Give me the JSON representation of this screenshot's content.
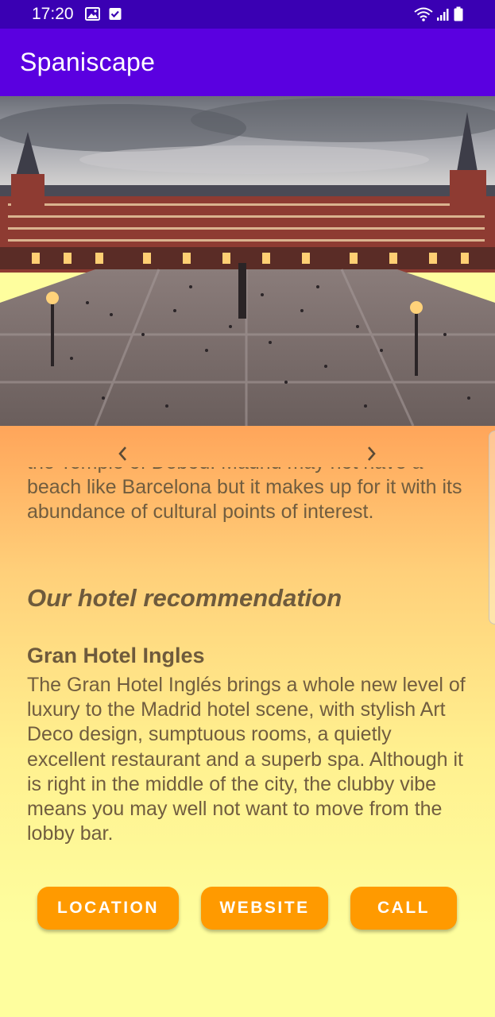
{
  "status_bar": {
    "time": "17:20",
    "left_icons": [
      "image-icon",
      "checkbox-icon"
    ],
    "right_icons": [
      "wifi-icon",
      "signal-icon",
      "battery-icon"
    ]
  },
  "app_bar": {
    "title": "Spaniscape"
  },
  "hero": {
    "image_alt": "photo of a large plaza surrounded by red buildings",
    "prev_icon": "chevron-left-icon",
    "next_icon": "chevron-right-icon"
  },
  "content": {
    "intro_partial": "the Temple of Debod. Madrid may not have a beach like Barcelona but it makes up for it with its abundance of cultural points of interest.",
    "recommendation_heading": "Our hotel recommendation",
    "hotel_name": "Gran Hotel Ingles",
    "hotel_description": "The Gran Hotel Inglés brings a whole new level of luxury to the Madrid hotel scene, with stylish Art Deco design, sumptuous rooms, a quietly excellent restaurant and a superb spa. Although it is right in the middle of the city, the clubby vibe means you may well not want to move from the lobby bar."
  },
  "actions": {
    "location_label": "LOCATION",
    "website_label": "WEBSITE",
    "call_label": "CALL"
  },
  "colors": {
    "status_bar": "#3a00b3",
    "app_bar": "#5a00e0",
    "button": "#ff9a00",
    "text": "#715d3f"
  }
}
